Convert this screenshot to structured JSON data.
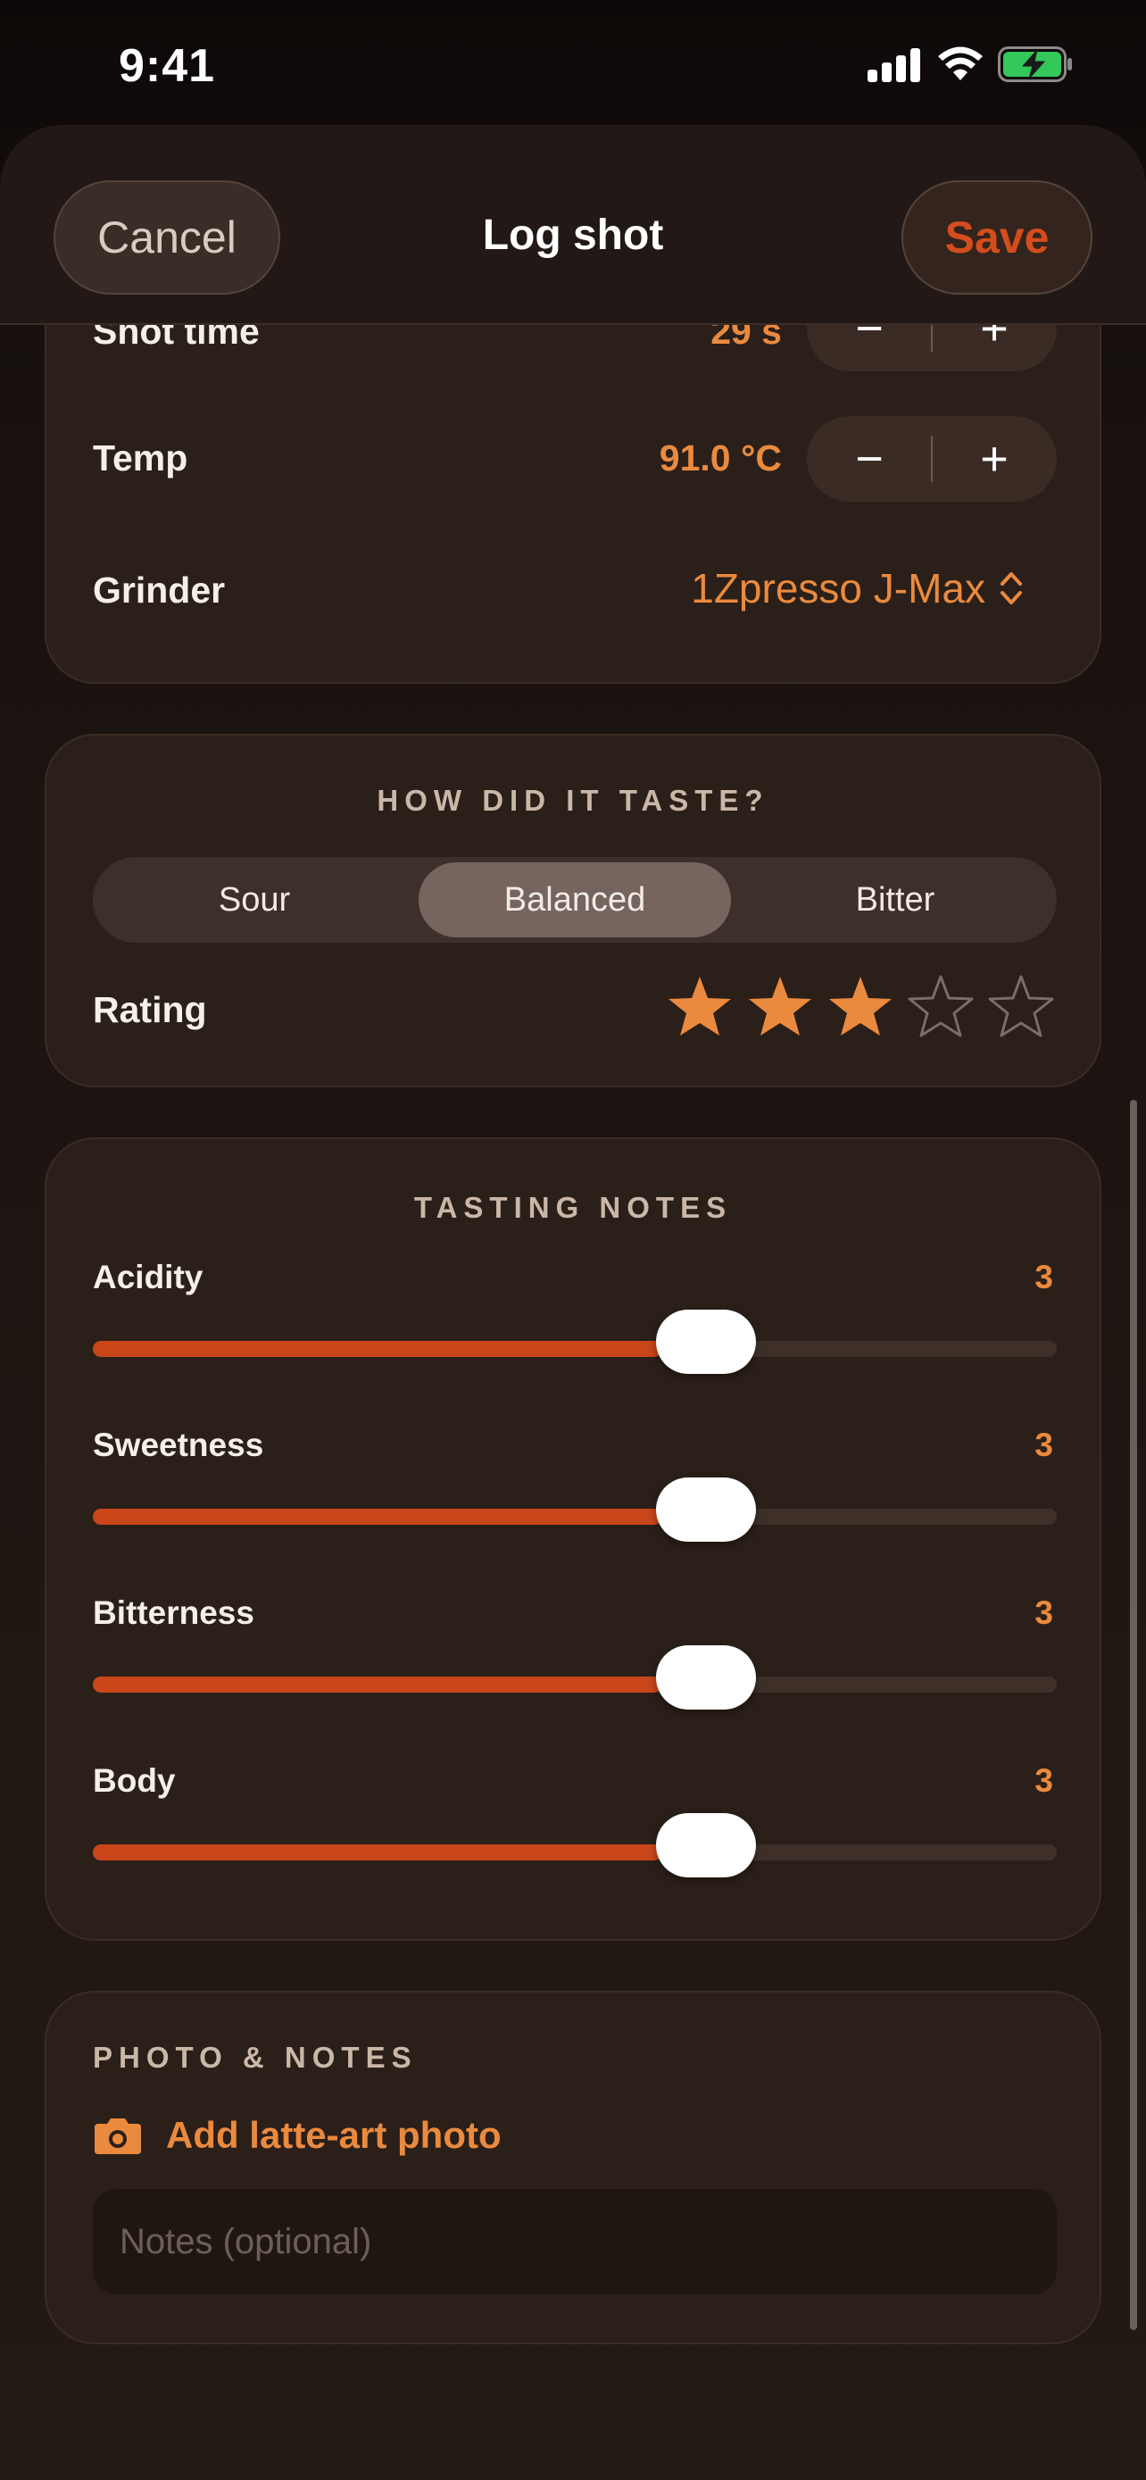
{
  "status_bar": {
    "time": "9:41"
  },
  "nav": {
    "cancel_label": "Cancel",
    "title": "Log shot",
    "save_label": "Save"
  },
  "parameters": {
    "shot_time": {
      "label": "Shot time",
      "value": "29 s"
    },
    "temp": {
      "label": "Temp",
      "value": "91.0 °C"
    },
    "grinder": {
      "label": "Grinder",
      "value": "1Zpresso J-Max"
    },
    "stepper_minus": "−",
    "stepper_plus": "+"
  },
  "taste": {
    "title": "HOW DID IT TASTE?",
    "options": [
      "Sour",
      "Balanced",
      "Bitter"
    ],
    "selected": "Balanced",
    "rating_label": "Rating",
    "rating": 3,
    "rating_max": 5
  },
  "tasting_notes": {
    "title": "TASTING NOTES",
    "sliders": [
      {
        "label": "Acidity",
        "value": "3",
        "fraction": 0.59
      },
      {
        "label": "Sweetness",
        "value": "3",
        "fraction": 0.59
      },
      {
        "label": "Bitterness",
        "value": "3",
        "fraction": 0.59
      },
      {
        "label": "Body",
        "value": "3",
        "fraction": 0.59
      }
    ]
  },
  "photo_notes": {
    "title": "PHOTO & NOTES",
    "add_photo_label": "Add latte-art photo",
    "notes_placeholder": "Notes (optional)",
    "notes_value": ""
  },
  "colors": {
    "accent": "#ea8a3e",
    "slider_fill": "#c9461a",
    "save": "#d44d1c"
  },
  "icons": {
    "camera": "camera-icon",
    "star": "star-icon",
    "chevron": "chevron-up-down-icon"
  }
}
